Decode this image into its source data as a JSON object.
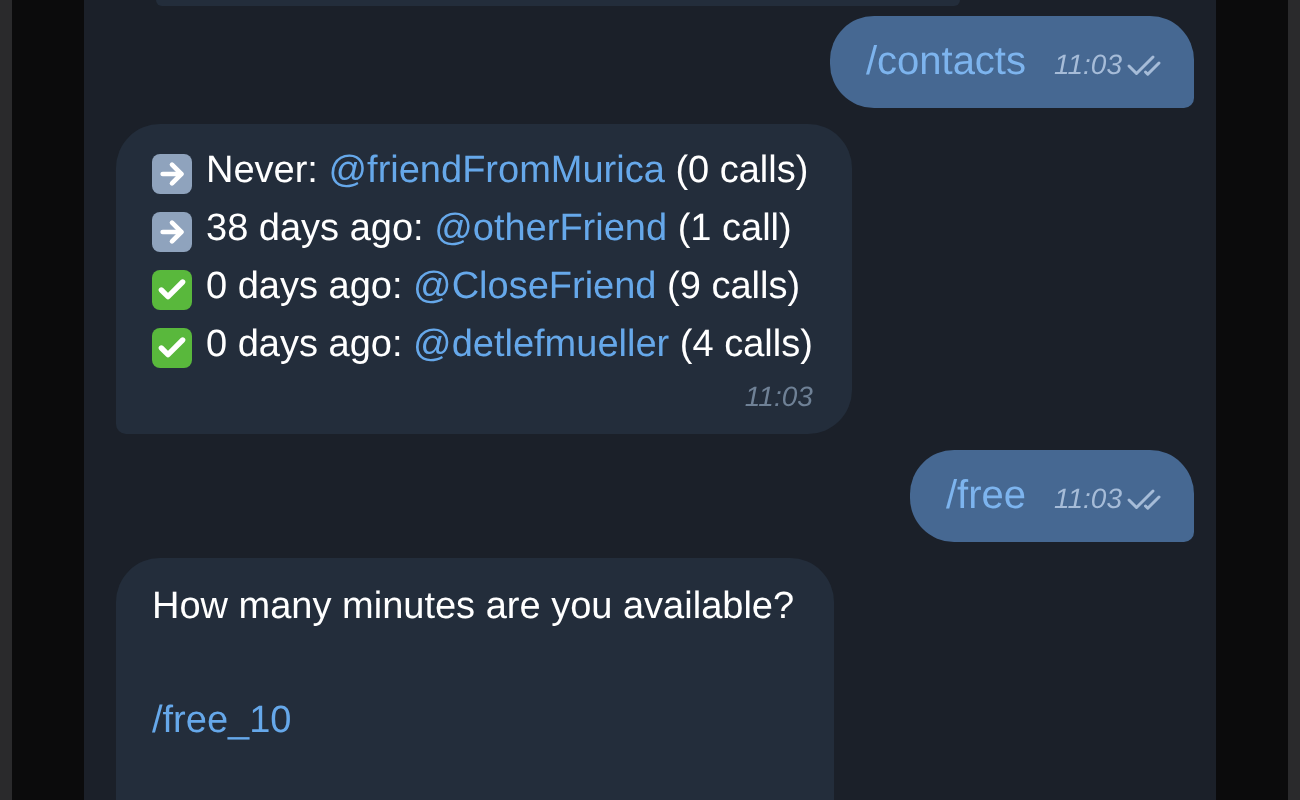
{
  "messages": [
    {
      "kind": "outgoing",
      "text": "/contacts",
      "time": "11:03",
      "read": true
    },
    {
      "kind": "incoming",
      "lines": [
        {
          "kind": "arrow",
          "prefix": "Never:",
          "mention": "@friendFromMurica",
          "suffix": "(0 calls)"
        },
        {
          "kind": "arrow",
          "prefix": "38 days ago:",
          "mention": "@otherFriend",
          "suffix": "(1 call)"
        },
        {
          "kind": "check",
          "prefix": "0 days ago:",
          "mention": "@CloseFriend",
          "suffix": "(9 calls)"
        },
        {
          "kind": "check",
          "prefix": "0 days ago:",
          "mention": "@detlefmueller",
          "suffix": "(4 calls)"
        }
      ],
      "time": "11:03"
    },
    {
      "kind": "outgoing",
      "text": "/free",
      "time": "11:03",
      "read": true
    },
    {
      "kind": "incoming",
      "text": "How many minutes are you available?",
      "command": "/free_10"
    }
  ]
}
